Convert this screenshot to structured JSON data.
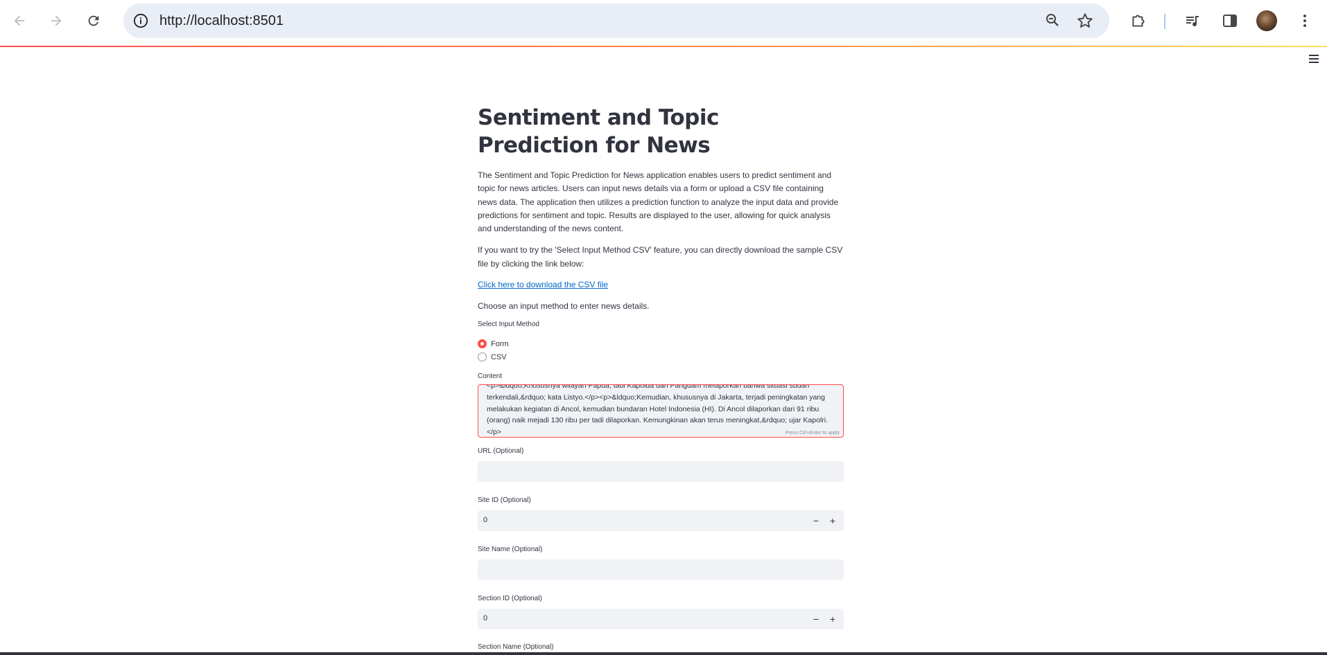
{
  "browser": {
    "url": "http://localhost:8501",
    "icons": [
      "back-icon",
      "forward-icon",
      "reload-icon",
      "info-icon",
      "zoom-icon",
      "star-icon",
      "extensions-icon",
      "media-icon",
      "side-panel-icon",
      "avatar",
      "menu-icon"
    ]
  },
  "app": {
    "title": "Sentiment and Topic Prediction for News",
    "description": "The Sentiment and Topic Prediction for News application enables users to predict sentiment and topic for news articles. Users can input news details via a form or upload a CSV file containing news data. The application then utilizes a prediction function to analyze the input data and provide predictions for sentiment and topic. Results are displayed to the user, allowing for quick analysis and understanding of the news content.",
    "csv_hint": "If you want to try the 'Select Input Method CSV' feature, you can directly download the sample CSV file by clicking the link below:",
    "download_link": "Click here to download the CSV file",
    "choose_text": "Choose an input method to enter news details.",
    "input_method": {
      "label": "Select Input Method",
      "options": [
        "Form",
        "CSV"
      ],
      "selected": "Form"
    },
    "content": {
      "label": "Content",
      "value": "<p>&ldquo;Khususnya wilayah Papua, tadi Kapolda dan Pangdam melaporkan bahwa situasi sudah terkendali,&rdquo; kata Listyo.</p><p>&ldquo;Kemudian, khususnya di Jakarta, terjadi peningkatan yang melakukan kegiatan di Ancol, kemudian bundaran Hotel Indonesia (HI). Di Ancol dilaporkan dari 91 ribu (orang) naik mejadi 130 ribu per tadi dilaporkan. Kemungkinan akan terus meningkat,&rdquo; ujar Kapolri.</p>",
      "hint": "Press Ctrl+Enter to apply"
    },
    "url_field": {
      "label": "URL (Optional)",
      "value": ""
    },
    "site_id": {
      "label": "Site ID (Optional)",
      "value": "0",
      "minus": "−",
      "plus": "+"
    },
    "site_name": {
      "label": "Site Name (Optional)",
      "value": ""
    },
    "section_id": {
      "label": "Section ID (Optional)",
      "value": "0",
      "minus": "−",
      "plus": "+"
    },
    "section_name": {
      "label": "Section Name (Optional)"
    }
  }
}
